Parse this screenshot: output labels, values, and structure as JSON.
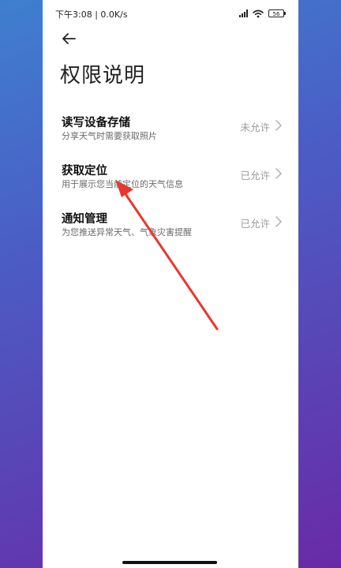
{
  "status_bar": {
    "time_network": "下午3:08 | 0.0K/s",
    "battery_level": "56",
    "icons": [
      "signal-icon",
      "wifi-icon",
      "battery-icon"
    ]
  },
  "header": {
    "back_icon": "arrow-left-icon",
    "title": "权限说明"
  },
  "permissions": [
    {
      "title": "读写设备存储",
      "description": "分享天气时需要获取照片",
      "status": "未允许"
    },
    {
      "title": "获取定位",
      "description": "用于展示您当前定位的天气信息",
      "status": "已允许"
    },
    {
      "title": "通知管理",
      "description": "为您推送异常天气、气象灾害提醒",
      "status": "已允许"
    }
  ],
  "colors": {
    "annotation_arrow": "#e8372f",
    "background_gradient_start": "#3f7fcf",
    "background_gradient_end": "#6a2aa6"
  }
}
